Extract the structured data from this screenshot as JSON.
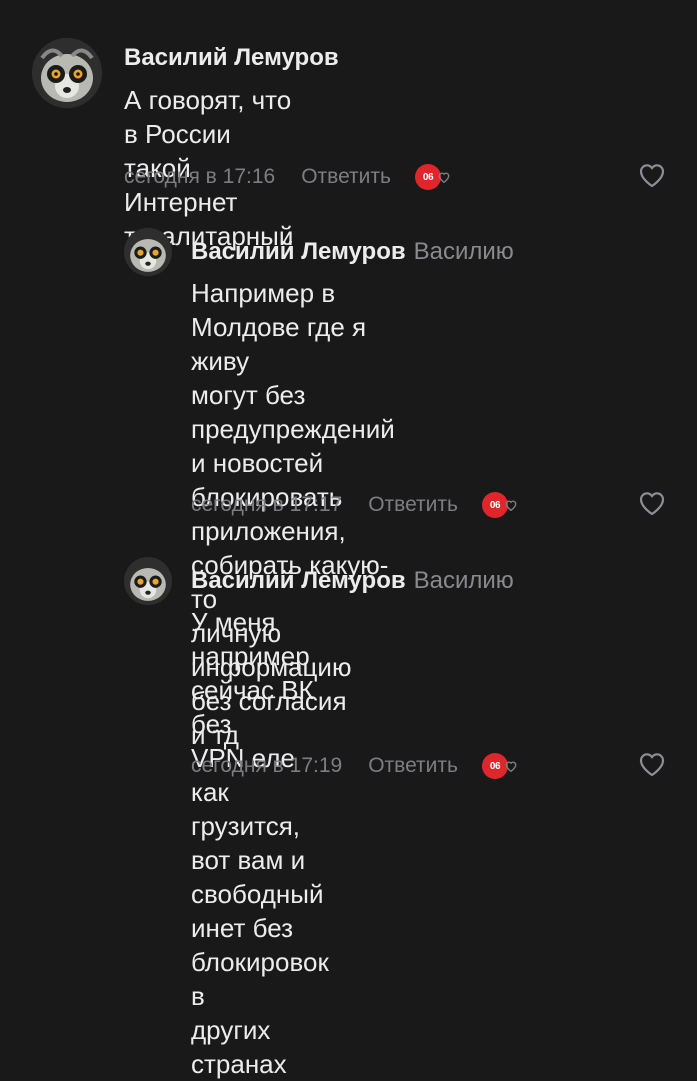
{
  "comments": [
    {
      "author": "Василий Лемуров",
      "reply_to": "",
      "lines": [
        "А говорят, что в России такой Интернет",
        "тоталитарный"
      ],
      "time": "сегодня в 17:16",
      "reply_label": "Ответить",
      "reaction_badge": "06"
    },
    {
      "author": "Василий Лемуров",
      "reply_to": "Василию",
      "lines": [
        "Например в Молдове где я живу",
        "могут без предупреждений",
        "и новостей блокировать",
        "приложения, собирать какую-то",
        "личную информацию без согласия",
        "и тд"
      ],
      "time": "сегодня в 17:17",
      "reply_label": "Ответить",
      "reaction_badge": "06"
    },
    {
      "author": "Василий Лемуров",
      "reply_to": "Василию",
      "lines": [
        "У меня например сейчас ВК без",
        "VPN еле как грузится, вот вам и",
        "свободный инет без блокировок в",
        "других странах"
      ],
      "time": "сегодня в 17:19",
      "reply_label": "Ответить",
      "reaction_badge": "06"
    }
  ],
  "colors": {
    "background": "#19191a",
    "text": "#ececec",
    "muted": "#7d7d82",
    "badge": "#e0262a"
  },
  "icons": {
    "avatar": "lemur-avatar",
    "reaction": "reaction-badge-icon",
    "like": "heart-outline-icon"
  }
}
